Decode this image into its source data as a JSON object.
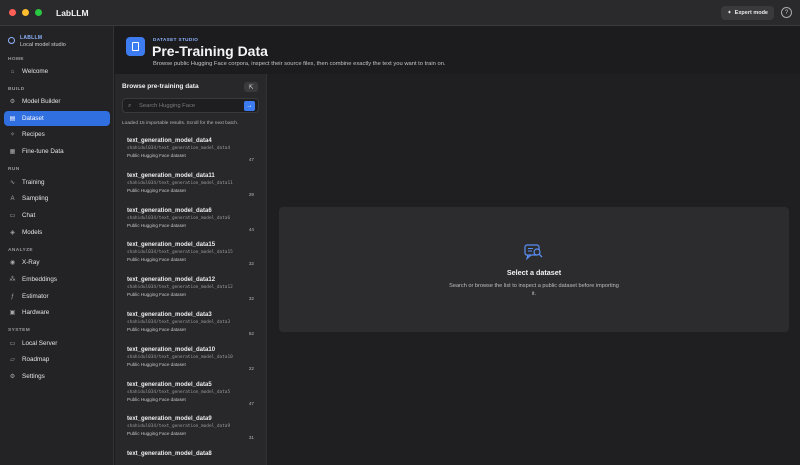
{
  "window": {
    "title": "LabLLM"
  },
  "toolbar": {
    "expert_mode_label": "Expert mode",
    "help_icon": "question-circle-icon"
  },
  "brand": {
    "name": "LABLLM",
    "subtitle": "Local model studio"
  },
  "sidebar": {
    "sections": [
      {
        "label": "HOME",
        "items": [
          {
            "label": "Welcome",
            "icon": "home-icon"
          }
        ]
      },
      {
        "label": "BUILD",
        "items": [
          {
            "label": "Model Builder",
            "icon": "gear-icon"
          },
          {
            "label": "Dataset",
            "icon": "document-icon",
            "active": true
          },
          {
            "label": "Recipes",
            "icon": "sparkle-icon"
          },
          {
            "label": "Fine-tune Data",
            "icon": "table-icon"
          }
        ]
      },
      {
        "label": "RUN",
        "items": [
          {
            "label": "Training",
            "icon": "pulse-icon"
          },
          {
            "label": "Sampling",
            "icon": "text-a-icon"
          },
          {
            "label": "Chat",
            "icon": "chat-icon"
          },
          {
            "label": "Models",
            "icon": "cube-icon"
          }
        ]
      },
      {
        "label": "ANALYZE",
        "items": [
          {
            "label": "X-Ray",
            "icon": "eye-icon"
          },
          {
            "label": "Embeddings",
            "icon": "nodes-icon"
          },
          {
            "label": "Estimator",
            "icon": "function-icon"
          },
          {
            "label": "Hardware",
            "icon": "chip-icon"
          }
        ]
      },
      {
        "label": "SYSTEM",
        "items": [
          {
            "label": "Local Server",
            "icon": "server-icon"
          },
          {
            "label": "Roadmap",
            "icon": "map-icon"
          },
          {
            "label": "Settings",
            "icon": "settings-icon"
          }
        ]
      }
    ]
  },
  "header": {
    "eyebrow": "DATASET STUDIO",
    "title": "Pre-Training Data",
    "subtitle": "Browse public Hugging Face corpora, inspect their source files, then combine exactly the text you want to train on."
  },
  "browse": {
    "title": "Browse pre-training data",
    "search_placeholder": "Search Hugging Face",
    "status": "Loaded 15 importable results. Scroll for the next batch.",
    "results": [
      {
        "name": "text_generation_model_data4",
        "path": "shahidul034/text_generation_model_data4",
        "type": "Public Hugging Face dataset",
        "count": "47"
      },
      {
        "name": "text_generation_model_data11",
        "path": "shahidul034/text_generation_model_data11",
        "type": "Public Hugging Face dataset",
        "count": "29"
      },
      {
        "name": "text_generation_model_data6",
        "path": "shahidul034/text_generation_model_data6",
        "type": "Public Hugging Face dataset",
        "count": "44"
      },
      {
        "name": "text_generation_model_data15",
        "path": "shahidul034/text_generation_model_data15",
        "type": "Public Hugging Face dataset",
        "count": "32"
      },
      {
        "name": "text_generation_model_data12",
        "path": "shahidul034/text_generation_model_data12",
        "type": "Public Hugging Face dataset",
        "count": "32"
      },
      {
        "name": "text_generation_model_data3",
        "path": "shahidul034/text_generation_model_data3",
        "type": "Public Hugging Face dataset",
        "count": "52"
      },
      {
        "name": "text_generation_model_data10",
        "path": "shahidul034/text_generation_model_data10",
        "type": "Public Hugging Face dataset",
        "count": "22"
      },
      {
        "name": "text_generation_model_data5",
        "path": "shahidul034/text_generation_model_data5",
        "type": "Public Hugging Face dataset",
        "count": "47"
      },
      {
        "name": "text_generation_model_data9",
        "path": "shahidul034/text_generation_model_data9",
        "type": "Public Hugging Face dataset",
        "count": "31"
      },
      {
        "name": "text_generation_model_data8",
        "path": "",
        "type": "",
        "count": ""
      }
    ]
  },
  "detail": {
    "empty_icon": "chat-search-icon",
    "empty_title": "Select a dataset",
    "empty_text": "Search or browse the list to inspect a public dataset before importing it."
  },
  "colors": {
    "accent": "#3d7bf0",
    "brand": "#8fb3ff",
    "sidebar_active": "#2f6fe0"
  }
}
